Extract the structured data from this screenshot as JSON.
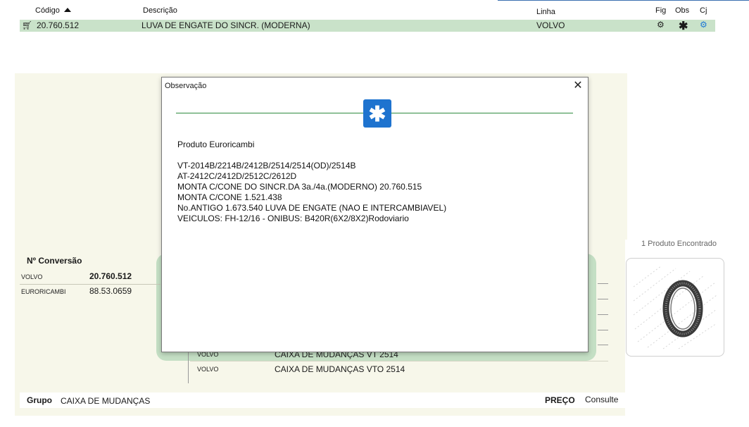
{
  "grid": {
    "headers": {
      "codigo": "Código",
      "descricao": "Descrição",
      "linha": "Linha",
      "fig": "Fig",
      "obs": "Obs",
      "cj": "Cj"
    },
    "row": {
      "codigo": "20.760.512",
      "descricao": "LUVA DE ENGATE DO SINCR. (MODERNA)",
      "linha": "VOLVO"
    }
  },
  "icons": {
    "cart": "cart-icon",
    "fig": "gear-icon",
    "obs": "asterisk-icon",
    "cj": "gears-icon"
  },
  "results": {
    "found": "1 Produto Encontrado"
  },
  "conversion": {
    "title": "Nº Conversão",
    "rows": [
      {
        "brand": "VOLVO",
        "code": "20.760.512"
      },
      {
        "brand": "EURORICAMBI",
        "code": "88.53.0659"
      }
    ]
  },
  "applications": [
    {
      "brand": "VOLVO",
      "desc": "CAIXA DE MUDANÇAS VT 2514"
    },
    {
      "brand": "VOLVO",
      "desc": "CAIXA DE MUDANÇAS VTO 2514"
    }
  ],
  "footer": {
    "grupo_label": "Grupo",
    "grupo_value": "CAIXA DE MUDANÇAS",
    "preco_label": "PREÇO",
    "preco_value": "Consulte"
  },
  "dialog": {
    "title": "Observação",
    "close": "✕",
    "badge": "✱",
    "lines": [
      "Produto Euroricambi",
      "",
      "VT-2014B/2214B/2412B/2514/2514(OD)/2514B",
      "AT-2412C/2412D/2512C/2612D",
      "MONTA C/CONE DO SINCR.DA 3a./4a.(MODERNO) 20.760.515",
      "MONTA C/CONE 1.521.438",
      "No.ANTIGO 1.673.540 LUVA DE ENGATE (NAO E INTERCAMBIAVEL)",
      "VEICULOS: FH-12/16 - ONIBUS: B420R(6X2/8X2)Rodoviario"
    ]
  },
  "colors": {
    "row_highlight": "#c9e2c9",
    "accent_green": "#2e8b3e",
    "badge_blue": "#1e73cf",
    "panel_bg": "#f7f7ea"
  }
}
